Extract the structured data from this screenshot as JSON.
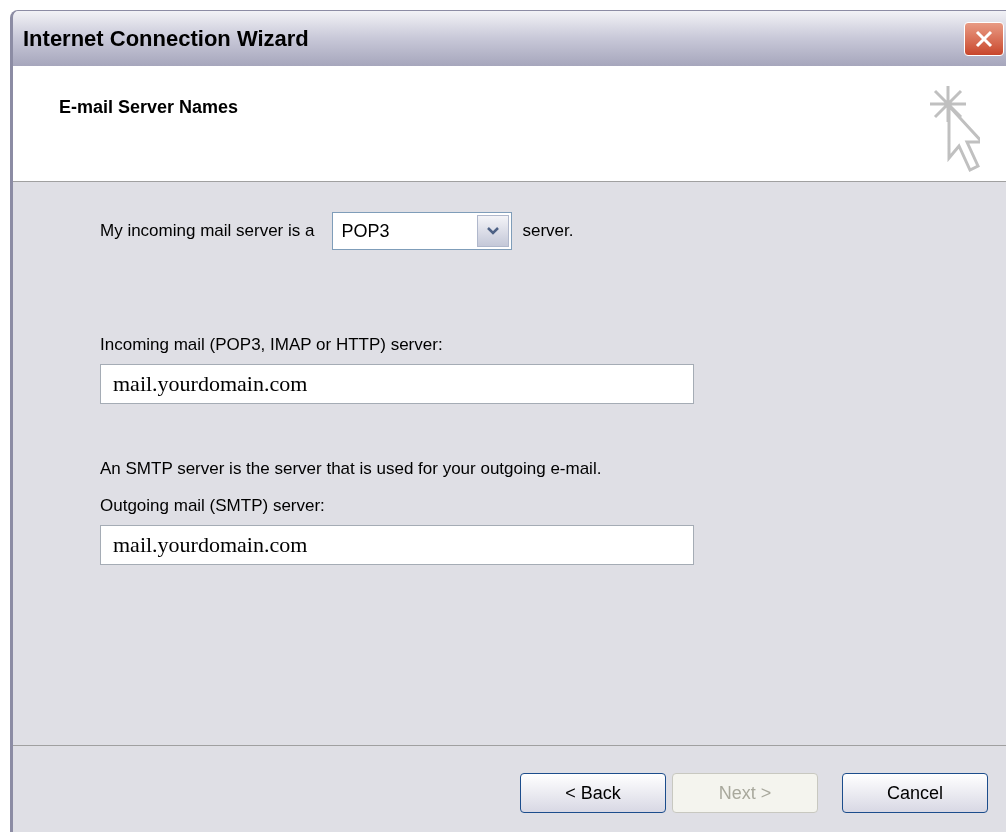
{
  "window": {
    "title": "Internet Connection Wizard"
  },
  "header": {
    "title": "E-mail Server Names"
  },
  "server_type": {
    "label_before": "My incoming mail server is a",
    "value": "POP3",
    "label_after": "server."
  },
  "incoming": {
    "label": "Incoming mail (POP3, IMAP or HTTP) server:",
    "value": "mail.yourdomain.com"
  },
  "smtp_note": "An SMTP server is the server that is used for your outgoing e-mail.",
  "outgoing": {
    "label": "Outgoing mail (SMTP) server:",
    "value": "mail.yourdomain.com"
  },
  "buttons": [
    {
      "label": "< Back",
      "disabled": false
    },
    {
      "label": "Next >",
      "disabled": true
    },
    {
      "label": "Cancel",
      "disabled": false
    }
  ]
}
